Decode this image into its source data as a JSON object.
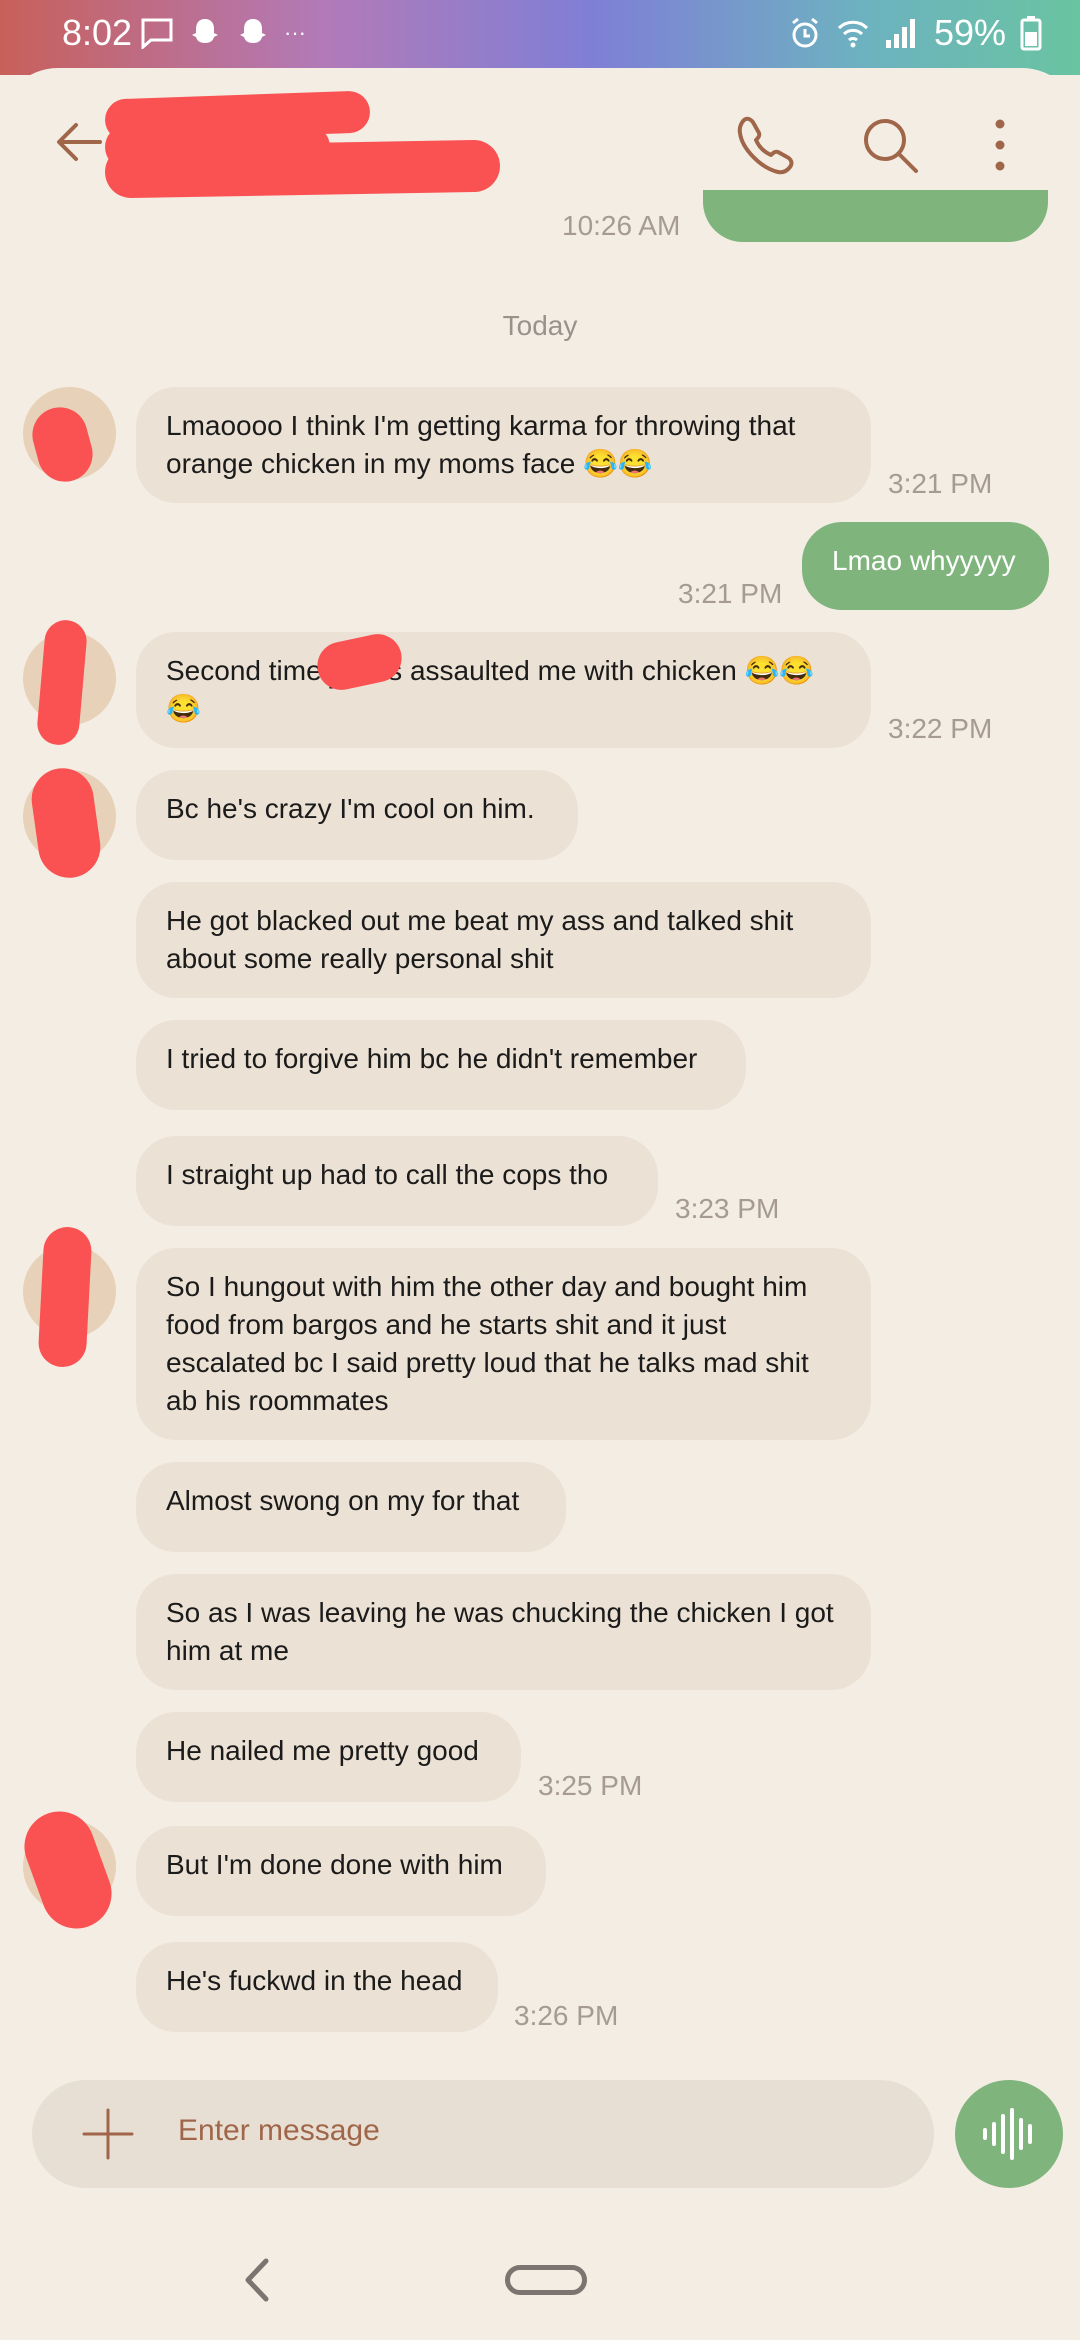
{
  "status_bar": {
    "time": "8:02",
    "battery": "59%",
    "more": "···"
  },
  "header": {
    "contact_name": "",
    "older_timestamp": "10:26 AM"
  },
  "conversation": {
    "date_separator": "Today",
    "messages": [
      {
        "dir": "in",
        "text": "Lmaoooo I think I'm getting karma for throwing that orange chicken in my moms face 😂😂",
        "time": "3:21 PM"
      },
      {
        "dir": "out",
        "text": "Lmao whyyyyy",
        "time": "3:21 PM"
      },
      {
        "dir": "in",
        "text": "Second time █ has assaulted me with chicken 😂😂😂",
        "time": "3:22 PM"
      },
      {
        "dir": "in",
        "text": "Bc he's crazy I'm cool on him.",
        "time": ""
      },
      {
        "dir": "in",
        "text": "He got blacked out me beat my ass and talked shit about some really personal shit",
        "time": ""
      },
      {
        "dir": "in",
        "text": "I tried to forgive him bc he didn't remember",
        "time": ""
      },
      {
        "dir": "in",
        "text": "I straight up had to call the cops tho",
        "time": "3:23 PM"
      },
      {
        "dir": "in",
        "text": "So I hungout with him the other day and bought him food from bargos and he starts shit and it just escalated bc I said pretty loud that he talks mad shit ab his roommates",
        "time": ""
      },
      {
        "dir": "in",
        "text": "Almost swong on my for that",
        "time": ""
      },
      {
        "dir": "in",
        "text": "So as I was leaving he was chucking the chicken I got him at me",
        "time": ""
      },
      {
        "dir": "in",
        "text": "He nailed me pretty good",
        "time": "3:25 PM"
      },
      {
        "dir": "in",
        "text": "But I'm done done with him",
        "time": ""
      },
      {
        "dir": "in",
        "text": "He's fuckwd in the head",
        "time": "3:26 PM"
      }
    ]
  },
  "composer": {
    "placeholder": "Enter message"
  },
  "icons": [
    "back-arrow-icon",
    "phone-icon",
    "search-icon",
    "more-vert-icon",
    "plus-icon",
    "voice-waveform-icon",
    "nav-back-icon",
    "nav-home-icon"
  ],
  "colors": {
    "background": "#f4ede4",
    "incoming_bubble": "#ebe1d4",
    "outgoing_bubble": "#7fb57c",
    "accent": "#a0664a",
    "redaction": "#fa5252"
  }
}
